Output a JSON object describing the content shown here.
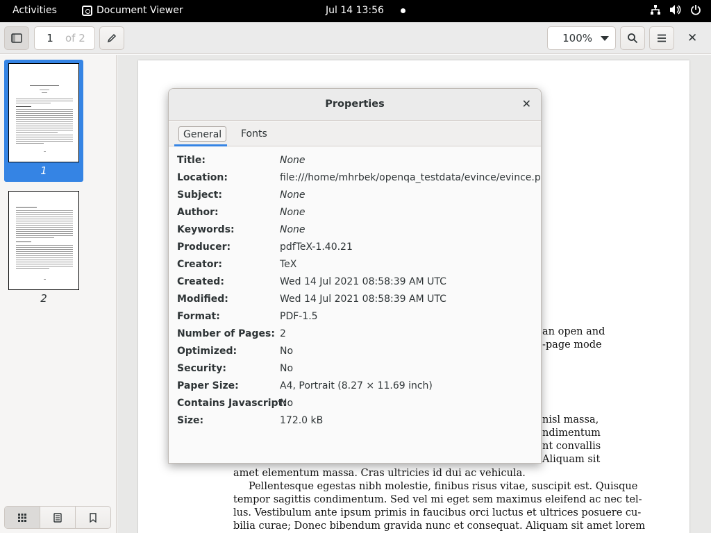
{
  "topbar": {
    "activities": "Activities",
    "app_name": "Document Viewer",
    "clock": "Jul 14  13:56",
    "icons": [
      "network-icon",
      "volume-icon",
      "power-icon"
    ]
  },
  "headerbar": {
    "page_current": "1",
    "page_total": "of 2",
    "zoom": "100%",
    "icons": [
      "sidebar-toggle-icon",
      "pencil-icon",
      "search-icon",
      "menu-icon",
      "close-icon"
    ]
  },
  "sidebar": {
    "thumbnails": [
      {
        "label": "1",
        "selected": true
      },
      {
        "label": "2",
        "selected": false
      }
    ],
    "bottom_buttons": [
      "thumbnails-icon",
      "outline-icon",
      "bookmark-icon"
    ]
  },
  "document": {
    "lines": [
      "an open and",
      "-page mode",
      "nisl massa,",
      "ndimentum",
      "nt convallis",
      "Aliquam sit",
      "amet elementum massa. Cras ultricies id dui ac vehicula.",
      "Pellentesque egestas nibh molestie, finibus risus vitae, suscipit est. Quisque",
      "tempor sagittis condimentum. Sed vel mi eget sem maximus eleifend ac nec tel-",
      "lus. Vestibulum ante ipsum primis in faucibus orci luctus et ultrices posuere cu-",
      "bilia curae; Donec bibendum gravida nunc et consequat. Aliquam sit amet lorem"
    ]
  },
  "dialog": {
    "title": "Properties",
    "close_icon": "close-icon",
    "tabs": [
      {
        "label": "General",
        "active": true
      },
      {
        "label": "Fonts",
        "active": false
      }
    ],
    "properties": [
      {
        "label": "Title:",
        "value": "None",
        "none": true
      },
      {
        "label": "Location:",
        "value": "file:///home/mhrbek/openqa_testdata/evince/evince.pdf",
        "none": false
      },
      {
        "label": "Subject:",
        "value": "None",
        "none": true
      },
      {
        "label": "Author:",
        "value": "None",
        "none": true
      },
      {
        "label": "Keywords:",
        "value": "None",
        "none": true
      },
      {
        "label": "Producer:",
        "value": "pdfTeX-1.40.21",
        "none": false
      },
      {
        "label": "Creator:",
        "value": "TeX",
        "none": false
      },
      {
        "label": "Created:",
        "value": "Wed 14 Jul 2021 08:58:39 AM UTC",
        "none": false
      },
      {
        "label": "Modified:",
        "value": "Wed 14 Jul 2021 08:58:39 AM UTC",
        "none": false
      },
      {
        "label": "Format:",
        "value": "PDF-1.5",
        "none": false
      },
      {
        "label": "Number of Pages:",
        "value": "2",
        "none": false
      },
      {
        "label": "Optimized:",
        "value": "No",
        "none": false
      },
      {
        "label": "Security:",
        "value": "No",
        "none": false
      },
      {
        "label": "Paper Size:",
        "value": "A4, Portrait (8.27 × 11.69 inch)",
        "none": false
      },
      {
        "label": "Contains Javascript:",
        "value": "No",
        "none": false
      },
      {
        "label": "Size:",
        "value": "172.0 kB",
        "none": false
      }
    ]
  }
}
